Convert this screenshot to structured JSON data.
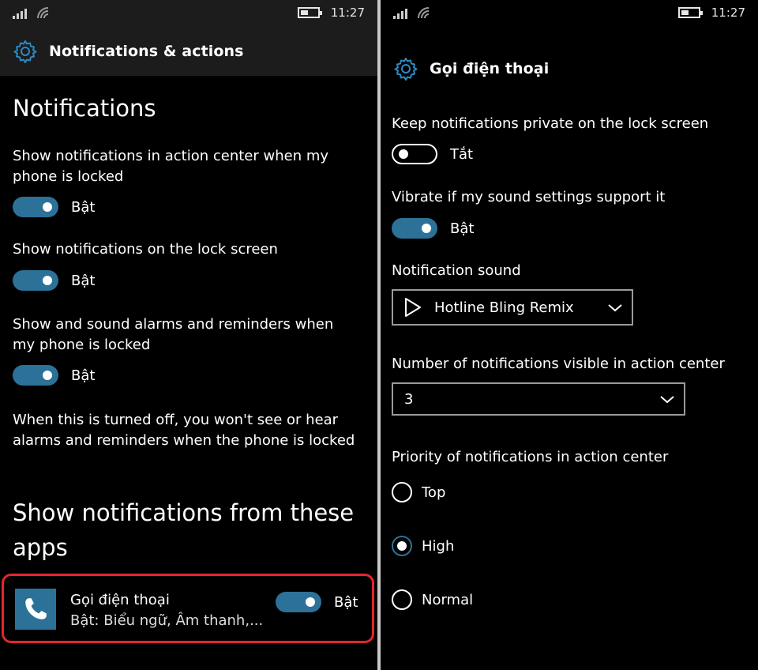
{
  "status": {
    "time": "11:27"
  },
  "left": {
    "header": {
      "title": "Notifications & actions"
    },
    "section_title": "Notifications",
    "settings": [
      {
        "label": "Show notifications in action center when my phone is locked",
        "state": "Bật"
      },
      {
        "label": "Show notifications on the lock screen",
        "state": "Bật"
      },
      {
        "label": "Show and sound alarms and reminders when my phone is locked",
        "state": "Bật"
      }
    ],
    "note": "When this is turned off, you won't see or hear alarms and reminders when the phone is locked",
    "apps_title": "Show notifications from these apps",
    "app": {
      "name": "Gọi điện thoại",
      "subtitle": "Bật: Biểu ngữ, Âm thanh,...",
      "state": "Bật"
    }
  },
  "right": {
    "header": {
      "title": "Gọi điện thoại"
    },
    "private": {
      "label": "Keep notifications private on the lock screen",
      "state": "Tắt"
    },
    "vibrate": {
      "label": "Vibrate if my sound settings support it",
      "state": "Bật"
    },
    "sound": {
      "label": "Notification sound",
      "value": "Hotline Bling Remix"
    },
    "count": {
      "label": "Number of notifications visible in action center",
      "value": "3"
    },
    "priority": {
      "label": "Priority of notifications in action center",
      "options": [
        "Top",
        "High",
        "Normal"
      ],
      "selected": "High"
    }
  },
  "colors": {
    "accent": "#2c7198",
    "highlight": "#e3262e",
    "background": "#000000"
  }
}
